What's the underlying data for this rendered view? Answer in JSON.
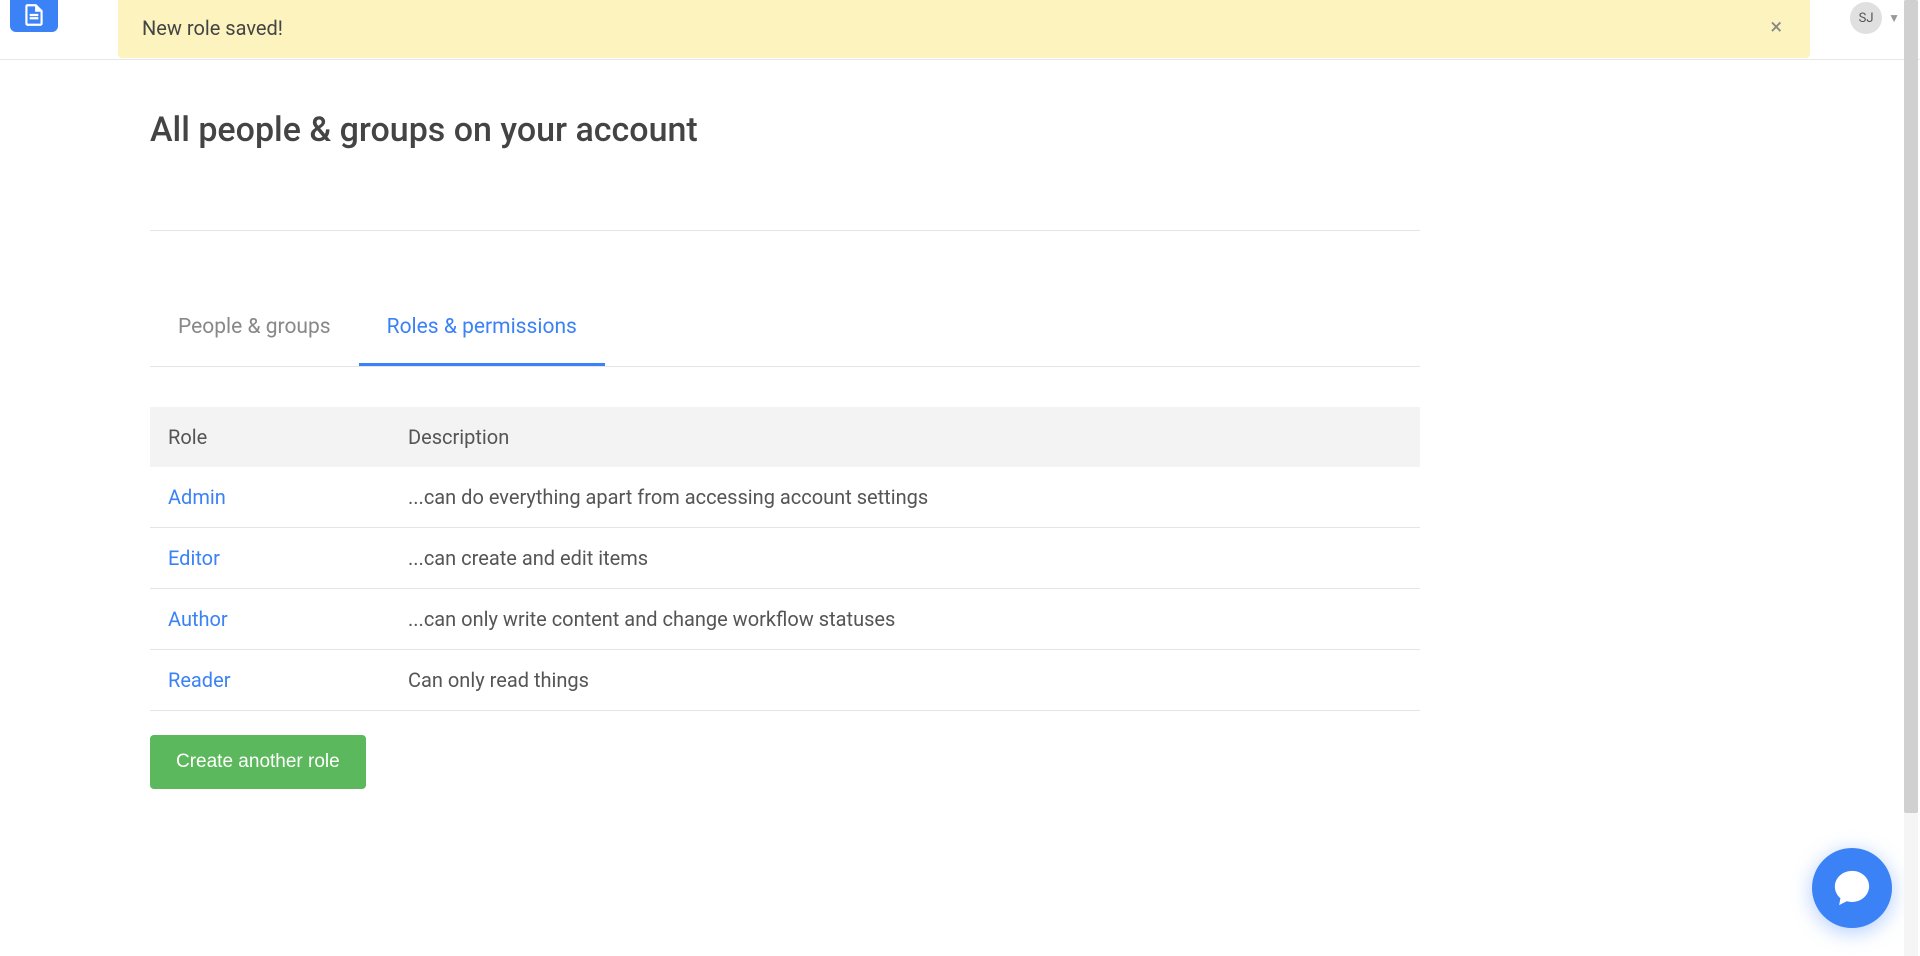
{
  "notification": {
    "message": "New role saved!",
    "close_label": "×"
  },
  "user": {
    "initials": "SJ"
  },
  "page": {
    "title": "All people & groups on your account"
  },
  "tabs": [
    {
      "label": "People & groups",
      "active": false
    },
    {
      "label": "Roles & permissions",
      "active": true
    }
  ],
  "table": {
    "headers": {
      "role": "Role",
      "description": "Description"
    },
    "rows": [
      {
        "role": "Admin",
        "description": "...can do everything apart from accessing account settings"
      },
      {
        "role": "Editor",
        "description": "...can create and edit items"
      },
      {
        "role": "Author",
        "description": "...can only write content and change workflow statuses"
      },
      {
        "role": "Reader",
        "description": "Can only read things"
      }
    ]
  },
  "buttons": {
    "create_role": "Create another role"
  }
}
